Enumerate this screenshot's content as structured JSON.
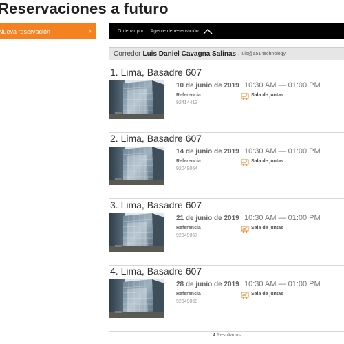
{
  "page": {
    "title": "Reservaciones a futuro"
  },
  "sidebar": {
    "new_reservation_label": "Nueva reservación"
  },
  "sort": {
    "label": "Ordenar por :",
    "value": "Agente de reservación"
  },
  "broker": {
    "prefix": "Corredor",
    "name": "Luis Daniel Cavagna Salinas",
    "meta": ", luis@a51 technology"
  },
  "reservations": [
    {
      "title": "1. Lima, Basadre 607",
      "date": "10 de junio de 2019",
      "time": "10:30 AM — 01:00 PM",
      "ref_label": "Referencia",
      "ref_value": "92414413",
      "room": "Sala de juntas"
    },
    {
      "title": "2. Lima, Basadre 607",
      "date": "14 de junio de 2019",
      "time": "10:30 AM — 01:00 PM",
      "ref_label": "Referencia",
      "ref_value": "92049064",
      "room": "Sala de juntas"
    },
    {
      "title": "3. Lima, Basadre 607",
      "date": "21 de junio de 2019",
      "time": "10:30 AM — 01:00 PM",
      "ref_label": "Referencia",
      "ref_value": "92049067",
      "room": "Sala de juntas"
    },
    {
      "title": "4. Lima, Basadre 607",
      "date": "28 de junio de 2019",
      "time": "10:30 AM — 01:00 PM",
      "ref_label": "Referencia",
      "ref_value": "92049068",
      "room": "Sala de juntas"
    }
  ],
  "footer": {
    "count": "4",
    "label": "Resultados"
  },
  "colors": {
    "accent": "#f58220",
    "sort_bar": "#000000",
    "broker_bar": "#e6e6e6"
  }
}
